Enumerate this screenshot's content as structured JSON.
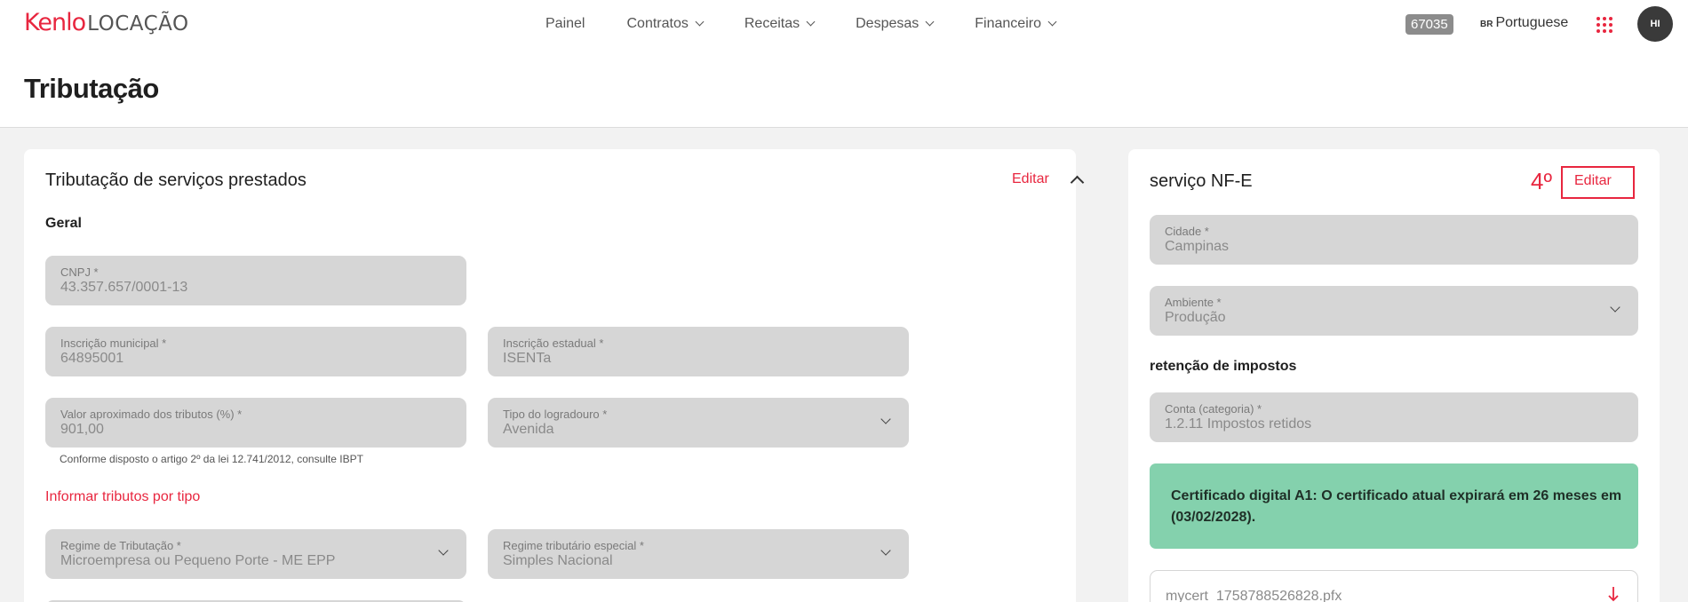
{
  "header": {
    "logo_brand": "Kenlo",
    "logo_sub": "LOCAÇÃO",
    "nav": [
      {
        "label": "Painel"
      },
      {
        "label": "Contratos"
      },
      {
        "label": "Receitas"
      },
      {
        "label": "Despesas"
      },
      {
        "label": "Financeiro"
      }
    ],
    "account_code": "67035",
    "lang_flag": "BR",
    "lang_label": "Portuguese",
    "avatar_initials": "HI"
  },
  "page": {
    "title": "Tributação"
  },
  "left_card": {
    "title": "Tributação de serviços prestados",
    "edit_label": "Editar",
    "section_geral": "Geral",
    "cnpj": {
      "label": "CNPJ *",
      "value": "43.357.657/0001-13"
    },
    "inscricao_municipal": {
      "label": "Inscrição municipal *",
      "value": "64895001"
    },
    "inscricao_estadual": {
      "label": "Inscrição estadual *",
      "value": "ISENTa"
    },
    "valor_tributos": {
      "label": "Valor aproximado dos tributos (%) *",
      "value": "901,00"
    },
    "tipo_logradouro": {
      "label": "Tipo do logradouro *",
      "value": "Avenida"
    },
    "hint": "Conforme disposto o artigo 2º da lei 12.741/2012, consulte IBPT",
    "informar_link": "Informar tributos por tipo",
    "regime": {
      "label": "Regime de Tributação *",
      "value": "Microempresa ou Pequeno Porte - ME EPP"
    },
    "regime_especial": {
      "label": "Regime tributário especial *",
      "value": "Simples Nacional"
    }
  },
  "right_card": {
    "title": "serviço NF-E",
    "edit_label": "Editar",
    "step_label": "4º",
    "cidade": {
      "label": "Cidade *",
      "value": "Campinas"
    },
    "ambiente": {
      "label": "Ambiente *",
      "value": "Produção"
    },
    "section_retencao": "retenção de impostos",
    "conta": {
      "label": "Conta (categoria) *",
      "value": "1.2.11 Impostos retidos"
    },
    "alert": "Certificado digital A1: O certificado atual expirará em 26 meses em (03/02/2028).",
    "certificate_file": "mycert_1758788526828.pfx"
  },
  "colors": {
    "accent": "#e8263f",
    "alert_bg": "#84d1ad",
    "field_bg": "#d6d6d6"
  }
}
